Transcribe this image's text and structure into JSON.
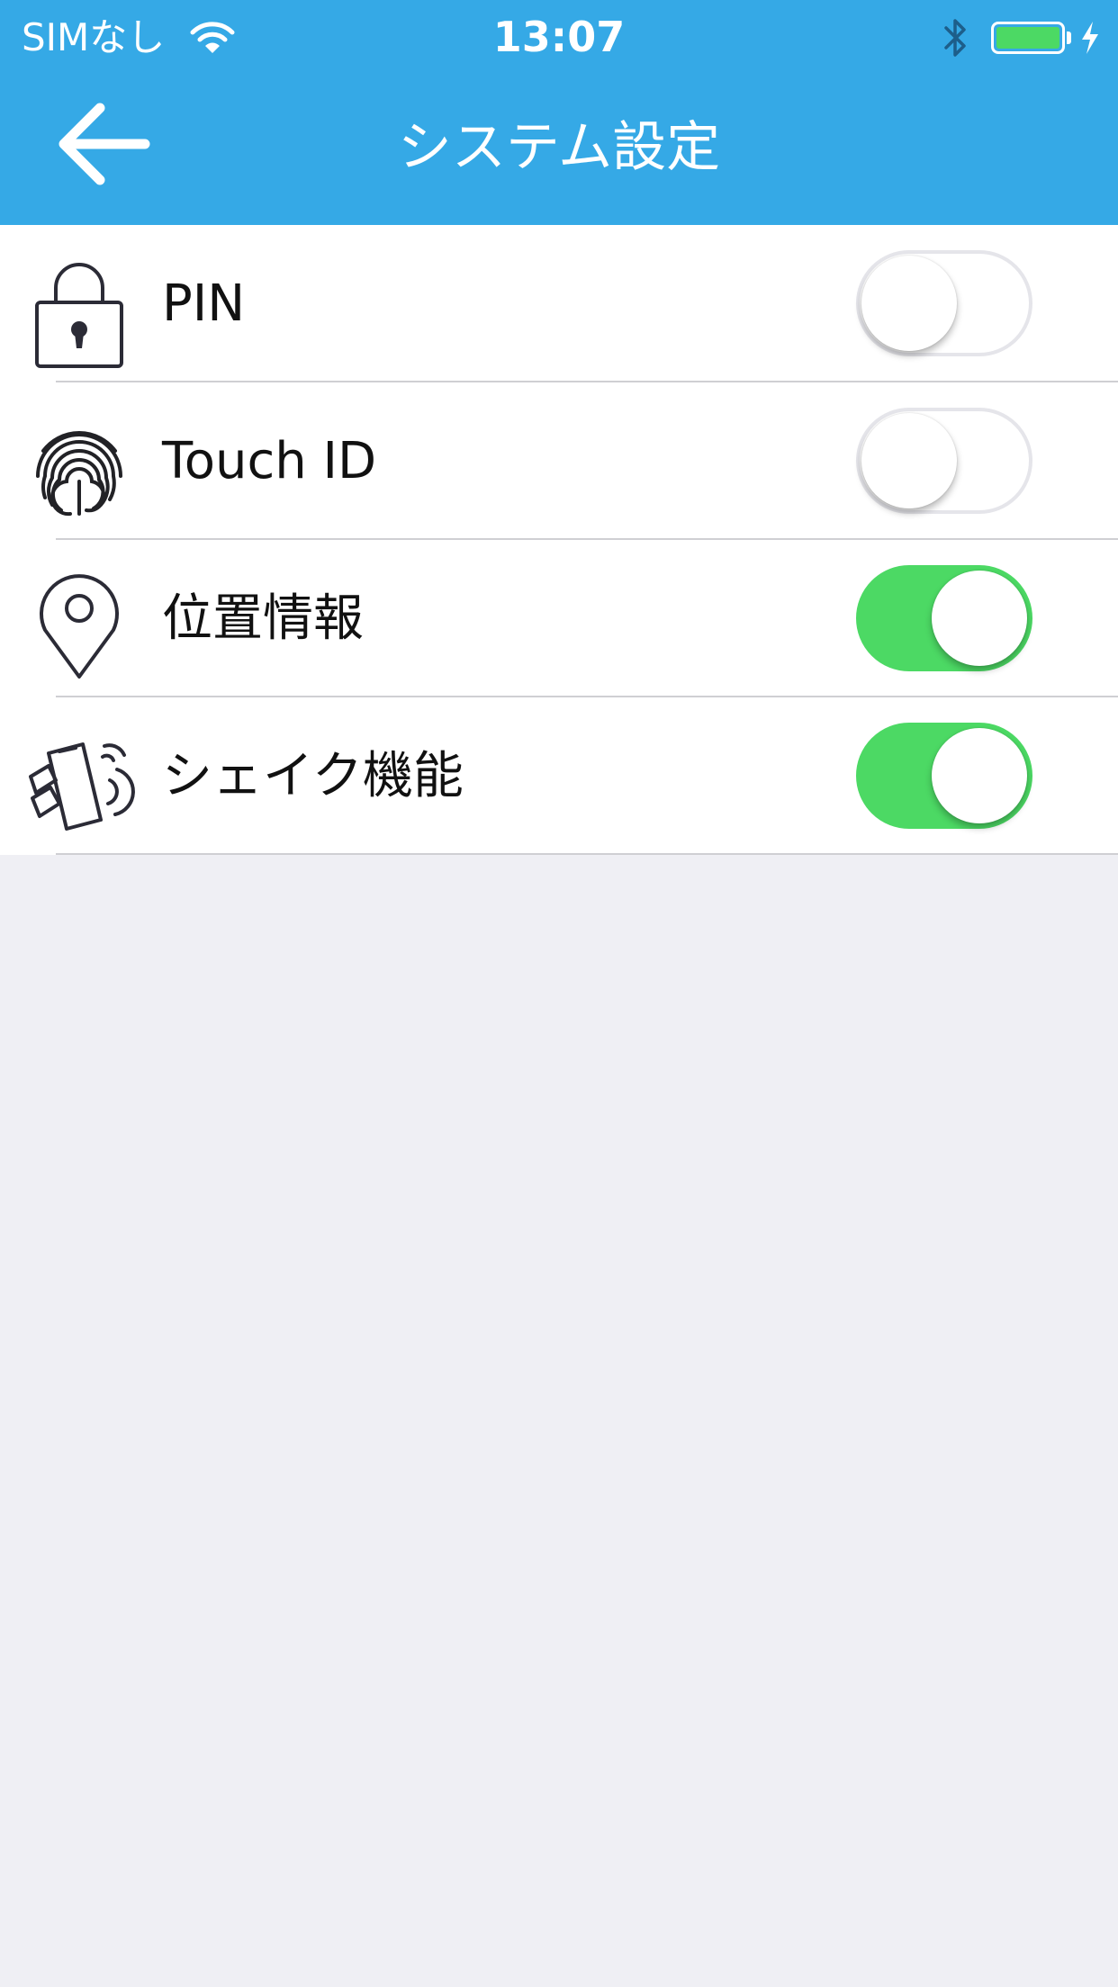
{
  "status_bar": {
    "carrier": "SIMなし",
    "time": "13:07",
    "wifi_icon": "wifi-icon",
    "bluetooth_icon": "bluetooth-icon",
    "battery_icon": "battery-icon",
    "charging_icon": "charging-bolt-icon"
  },
  "nav": {
    "title": "システム設定",
    "back_icon": "arrow-left-icon"
  },
  "settings": [
    {
      "label": "PIN",
      "icon": "lock-icon",
      "enabled": false
    },
    {
      "label": "Touch ID",
      "icon": "fingerprint-icon",
      "enabled": false
    },
    {
      "label": "位置情報",
      "icon": "location-pin-icon",
      "enabled": true
    },
    {
      "label": "シェイク機能",
      "icon": "shake-phone-icon",
      "enabled": true
    }
  ],
  "colors": {
    "header": "#35a9e6",
    "toggle_on": "#4cd964",
    "toggle_off_border": "#e5e5ea",
    "background": "#efeff4"
  }
}
